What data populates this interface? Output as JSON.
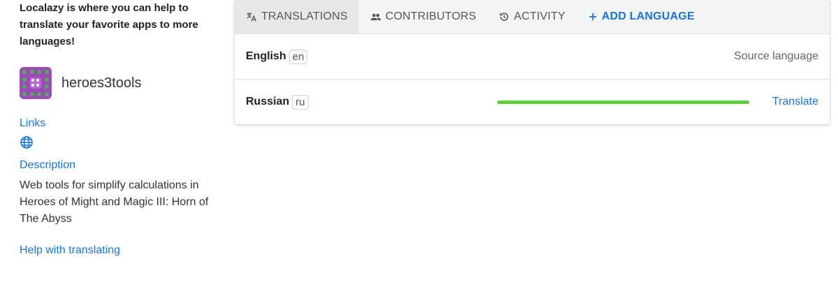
{
  "sidebar": {
    "intro": "Localazy is where you can help to translate your favorite apps to more languages!",
    "app_name": "heroes3tools",
    "links_label": "Links",
    "description_label": "Description",
    "description_text": "Web tools for simplify calculations in Heroes of Might and Magic III: Horn of The Abyss",
    "help_link": "Help with translating"
  },
  "tabs": [
    {
      "label": "TRANSLATIONS",
      "icon": "translate-icon"
    },
    {
      "label": "CONTRIBUTORS",
      "icon": "people-icon"
    },
    {
      "label": "ACTIVITY",
      "icon": "history-icon"
    },
    {
      "label": "ADD LANGUAGE",
      "icon": "plus-icon"
    }
  ],
  "languages": [
    {
      "name": "English",
      "code": "en",
      "status": "Source language"
    },
    {
      "name": "Russian",
      "code": "ru",
      "action": "Translate",
      "progress": 1.0
    }
  ],
  "colors": {
    "accent": "#1a73d9",
    "progress": "#5fcf3f",
    "logo": "#9c4ab8"
  }
}
